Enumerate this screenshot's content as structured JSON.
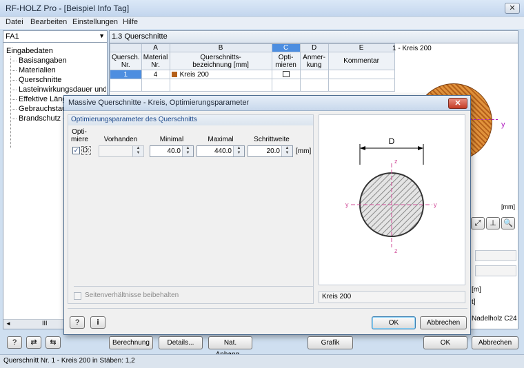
{
  "window": {
    "title": "RF-HOLZ Pro - [Beispiel Info Tag]"
  },
  "menu": [
    "Datei",
    "Bearbeiten",
    "Einstellungen",
    "Hilfe"
  ],
  "left_panel": {
    "combo_value": "FA1",
    "tree_root": "Eingabedaten",
    "tree_items": [
      "Basisangaben",
      "Materialien",
      "Querschnitte",
      "Lasteinwirkungsdauer und Nutz",
      "Effektive Längen - Stäbe",
      "Gebrauchstauglichkeit",
      "Brandschutz - Stäbe"
    ],
    "scroll_grip": "III"
  },
  "table": {
    "section_title": "1.3 Querschnitte",
    "col_letters": [
      "A",
      "B",
      "C",
      "D",
      "E"
    ],
    "headers": [
      "Quersch.\nNr.",
      "Material\nNr.",
      "Querschnitts-\nbezeichnung [mm]",
      "Opti-\nmieren",
      "Anmer-\nkung",
      "Kommentar"
    ],
    "row": {
      "nr": "1",
      "material": "4",
      "bezeichnung": "Kreis 200",
      "material_color": "#b5601a"
    }
  },
  "preview": {
    "title": "1 - Kreis 200",
    "unit": "[mm]",
    "y_axis": "y"
  },
  "right_fragments": {
    "unit_m": "[m]",
    "unit_t": "t]",
    "material": "Nadelholz C24"
  },
  "dialog": {
    "title": "Massive Querschnitte - Kreis, Optimierungsparameter",
    "close_symbol": "✕",
    "group_title": "Optimierungsparameter des Querschnitts",
    "col_opt": "Opti-\nmiere",
    "col_vorhanden": "Vorhanden",
    "col_minimal": "Minimal",
    "col_maximal": "Maximal",
    "col_schrittweite": "Schrittweite",
    "param_label": "D:",
    "minimal": "40.0",
    "maximal": "440.0",
    "schrittweite": "20.0",
    "unit": "[mm]",
    "keep_ratio": "Seitenverhältnisse beibehalten",
    "image_label": "Kreis 200",
    "diagram": {
      "dim": "D",
      "z": "z",
      "y": "y"
    },
    "ok": "OK",
    "cancel": "Abbrechen"
  },
  "bottom": {
    "berechnung": "Berechnung",
    "details": "Details...",
    "nat_anhang": "Nat. Anhang...",
    "grafik": "Grafik",
    "ok": "OK",
    "cancel": "Abbrechen"
  },
  "status": "Querschnitt Nr. 1 - Kreis 200 in Stäben: 1,2"
}
